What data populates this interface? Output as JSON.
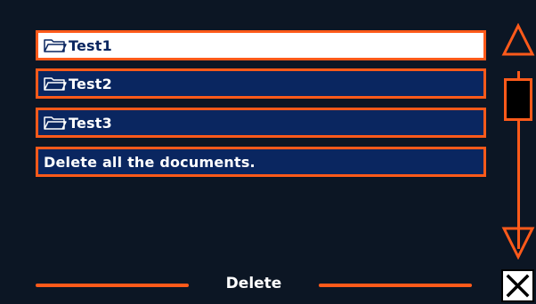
{
  "files": [
    {
      "label": "Test1",
      "icon": "folder-icon",
      "selected": true
    },
    {
      "label": "Test2",
      "icon": "folder-icon",
      "selected": false
    },
    {
      "label": "Test3",
      "icon": "folder-icon",
      "selected": false
    }
  ],
  "delete_all_label": "Delete all the documents.",
  "footer": {
    "action_label": "Delete"
  },
  "scrollbar": {
    "up_icon": "triangle-up-icon",
    "down_icon": "triangle-down-icon"
  },
  "close_icon": "close-icon",
  "colors": {
    "background": "#0c1624",
    "accent": "#ff5a1a",
    "item_fill": "#0a2660",
    "selected_fill": "#ffffff"
  }
}
